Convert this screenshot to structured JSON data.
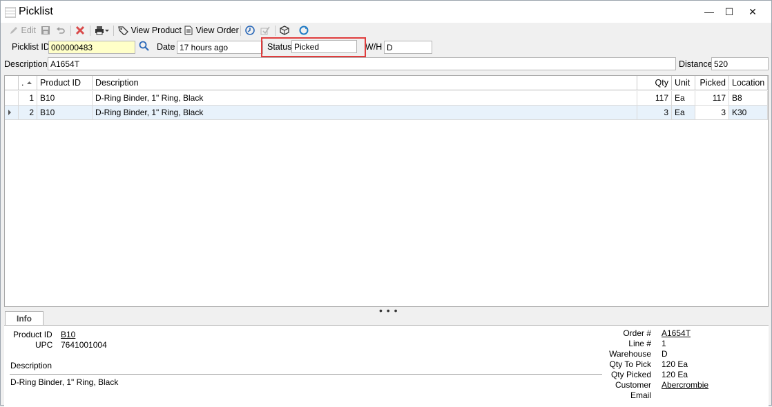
{
  "window": {
    "title": "Picklist",
    "minimize": "—",
    "maximize": "☐",
    "close": "✕"
  },
  "toolbar": {
    "edit": "Edit",
    "view_product": "View Product",
    "view_order": "View Order"
  },
  "header": {
    "picklist_id_label": "Picklist ID",
    "picklist_id": "000000483",
    "date_label": "Date",
    "date": "17 hours ago",
    "status_label": "Status",
    "status": "Picked",
    "wh_label": "W/H",
    "wh": "D",
    "description_label": "Description",
    "description": "A1654T",
    "distance_label": "Distance",
    "distance": "520"
  },
  "grid": {
    "columns": {
      "dot": ".",
      "product_id": "Product ID",
      "description": "Description",
      "qty": "Qty",
      "unit": "Unit",
      "picked": "Picked",
      "location": "Location"
    },
    "rows": [
      {
        "n": "1",
        "product_id": "B10",
        "description": "D-Ring Binder, 1\" Ring, Black",
        "qty": "117",
        "unit": "Ea",
        "picked": "117",
        "location": "B8"
      },
      {
        "n": "2",
        "product_id": "B10",
        "description": "D-Ring Binder, 1\" Ring, Black",
        "qty": "3",
        "unit": "Ea",
        "picked": "3",
        "location": "K30"
      }
    ]
  },
  "info": {
    "tab": "Info",
    "product_id_label": "Product ID",
    "product_id": "B10",
    "upc_label": "UPC",
    "upc": "7641001004",
    "description_label": "Description",
    "description": "D-Ring Binder, 1\" Ring, Black",
    "order_label": "Order #",
    "order": "A1654T",
    "line_label": "Line #",
    "line": "1",
    "warehouse_label": "Warehouse",
    "warehouse": "D",
    "qty_to_pick_label": "Qty To Pick",
    "qty_to_pick": "120 Ea",
    "qty_picked_label": "Qty Picked",
    "qty_picked": "120 Ea",
    "customer_label": "Customer",
    "customer": "Abercrombie",
    "email_label": "Email"
  }
}
